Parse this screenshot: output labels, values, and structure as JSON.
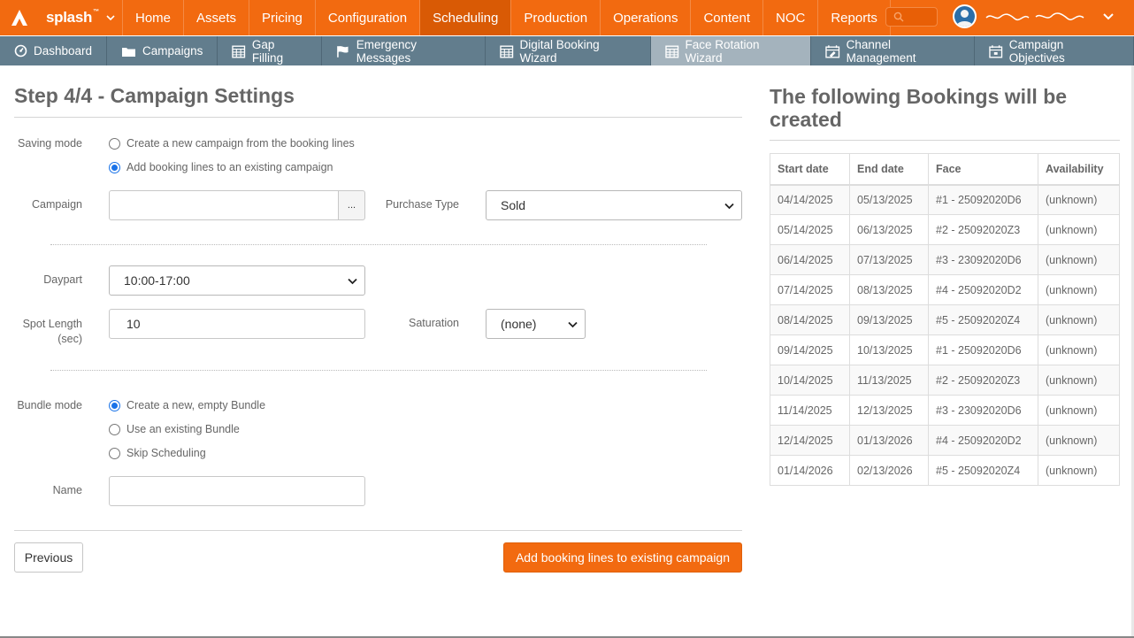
{
  "brand": {
    "name": "splash",
    "tm": "™"
  },
  "top_nav": [
    "Home",
    "Assets",
    "Pricing",
    "Configuration",
    "Scheduling",
    "Production",
    "Operations",
    "Content",
    "NOC",
    "Reports"
  ],
  "top_nav_active": "Scheduling",
  "sub_nav": [
    {
      "label": "Dashboard",
      "icon": "dashboard-icon"
    },
    {
      "label": "Campaigns",
      "icon": "folder-icon"
    },
    {
      "label": "Gap Filling",
      "icon": "calendar-grid-icon"
    },
    {
      "label": "Emergency Messages",
      "icon": "flag-icon"
    },
    {
      "label": "Digital Booking Wizard",
      "icon": "calendar-grid-icon"
    },
    {
      "label": "Face Rotation Wizard",
      "icon": "calendar-grid-icon"
    },
    {
      "label": "Channel Management",
      "icon": "calendar-edit-icon"
    },
    {
      "label": "Campaign Objectives",
      "icon": "calendar-icon"
    }
  ],
  "sub_nav_active": "Face Rotation Wizard",
  "form": {
    "title": "Step 4/4 - Campaign Settings",
    "saving_mode_label": "Saving mode",
    "saving_mode_options": [
      "Create a new campaign from the booking lines",
      "Add booking lines to an existing campaign"
    ],
    "saving_mode_selected": 1,
    "campaign_label": "Campaign",
    "campaign_value": "",
    "campaign_picker": "...",
    "purchase_type_label": "Purchase Type",
    "purchase_type_value": "Sold",
    "daypart_label": "Daypart",
    "daypart_value": "10:00-17:00",
    "spot_length_label": "Spot Length",
    "spot_length_unit": "(sec)",
    "spot_length_value": "10",
    "saturation_label": "Saturation",
    "saturation_value": "(none)",
    "bundle_mode_label": "Bundle mode",
    "bundle_mode_options": [
      "Create a new, empty Bundle",
      "Use an existing Bundle",
      "Skip Scheduling"
    ],
    "bundle_mode_selected": 0,
    "name_label": "Name",
    "name_value": "",
    "previous_button": "Previous",
    "submit_button": "Add booking lines to existing campaign"
  },
  "bookings": {
    "title": "The following Bookings will be created",
    "columns": [
      "Start date",
      "End date",
      "Face",
      "Availability"
    ],
    "rows": [
      [
        "04/14/2025",
        "05/13/2025",
        "#1 - 25092020D6",
        "(unknown)"
      ],
      [
        "05/14/2025",
        "06/13/2025",
        "#2 - 25092020Z3",
        "(unknown)"
      ],
      [
        "06/14/2025",
        "07/13/2025",
        "#3 - 23092020D6",
        "(unknown)"
      ],
      [
        "07/14/2025",
        "08/13/2025",
        "#4 - 25092020D2",
        "(unknown)"
      ],
      [
        "08/14/2025",
        "09/13/2025",
        "#5 - 25092020Z4",
        "(unknown)"
      ],
      [
        "09/14/2025",
        "10/13/2025",
        "#1 - 25092020D6",
        "(unknown)"
      ],
      [
        "10/14/2025",
        "11/13/2025",
        "#2 - 25092020Z3",
        "(unknown)"
      ],
      [
        "11/14/2025",
        "12/13/2025",
        "#3 - 23092020D6",
        "(unknown)"
      ],
      [
        "12/14/2025",
        "01/13/2026",
        "#4 - 25092020D2",
        "(unknown)"
      ],
      [
        "01/14/2026",
        "02/13/2026",
        "#5 - 25092020Z4",
        "(unknown)"
      ]
    ]
  },
  "colors": {
    "brand_orange": "#f26a10",
    "subnav_slate": "#627d8d",
    "radio_blue": "#1a73e8"
  }
}
